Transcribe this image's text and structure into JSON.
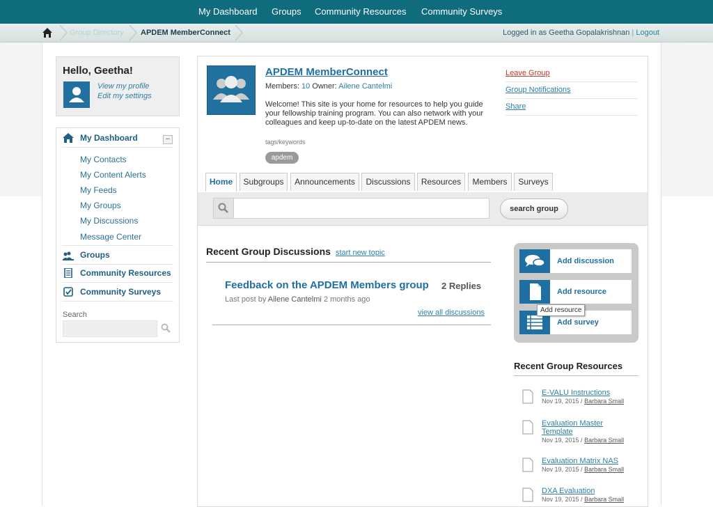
{
  "topnav": {
    "items": [
      "My Dashboard",
      "Groups",
      "Community Resources",
      "Community Surveys"
    ]
  },
  "breadcrumb": {
    "faded": "Group Directory",
    "current": "APDEM MemberConnect"
  },
  "login": {
    "prefix": "Logged in as Geetha Gopalakrishnan",
    "separator": "|",
    "logout": "Logout"
  },
  "hello": {
    "greeting": "Hello, Geetha!",
    "view_profile": "View my profile",
    "edit_settings": "Edit my settings"
  },
  "leftnav": {
    "dashboard": "My Dashboard",
    "collapse": "–",
    "sub_items": [
      "My Contacts",
      "My Content Alerts",
      "My Feeds",
      "My Groups",
      "My Discussions",
      "Message Center"
    ],
    "groups": "Groups",
    "resources": "Community Resources",
    "surveys": "Community Surveys",
    "search_label": "Search"
  },
  "group": {
    "title": "APDEM MemberConnect",
    "members_label": "Members:",
    "members_count": "10",
    "owner_label": "Owner:",
    "owner_name": "Ailene Cantelmi",
    "description": "Welcome! This site is your home for resources to help you guide your fellowship training program. You can also network with your colleagues and keep up-to-date on the latest APDEM news.",
    "tags_label": "tags/keywords",
    "tag": "apdem",
    "actions": {
      "leave": "Leave Group",
      "notifications": "Group Notifications",
      "share": "Share"
    },
    "colors": {
      "leave": "#c0392b",
      "accent": "#1f6fa3"
    }
  },
  "tabs": [
    "Home",
    "Subgroups",
    "Announcements",
    "Discussions",
    "Resources",
    "Members",
    "Surveys"
  ],
  "search": {
    "button": "search group",
    "value": ""
  },
  "discussions": {
    "heading": "Recent Group Discussions",
    "start_link": "start new topic",
    "item_title": "Feedback on the APDEM Members group",
    "replies": "2 Replies",
    "last_post_prefix": "Last post by",
    "last_post_author": "Ailene Cantelmi",
    "last_post_time": "2 months ago",
    "view_all": "view all discussions"
  },
  "add_box": {
    "discussion": "Add discussion",
    "resource": "Add resource",
    "survey": "Add survey",
    "tooltip": "Add resource"
  },
  "resources": {
    "heading": "Recent Group Resources",
    "items": [
      {
        "title": "E-VALU Instructions",
        "date": "Nov 19, 2015 /",
        "author": "Barbara Small"
      },
      {
        "title": "Evaluation Master Template",
        "date": "Nov 19, 2015 /",
        "author": "Barbara Small"
      },
      {
        "title": "Evaluation Matrix NAS",
        "date": "Nov 19, 2015 /",
        "author": "Barbara Small"
      },
      {
        "title": "DXA Evaluation",
        "date": "Nov 19, 2015 /",
        "author": "Barbara Small"
      }
    ]
  }
}
